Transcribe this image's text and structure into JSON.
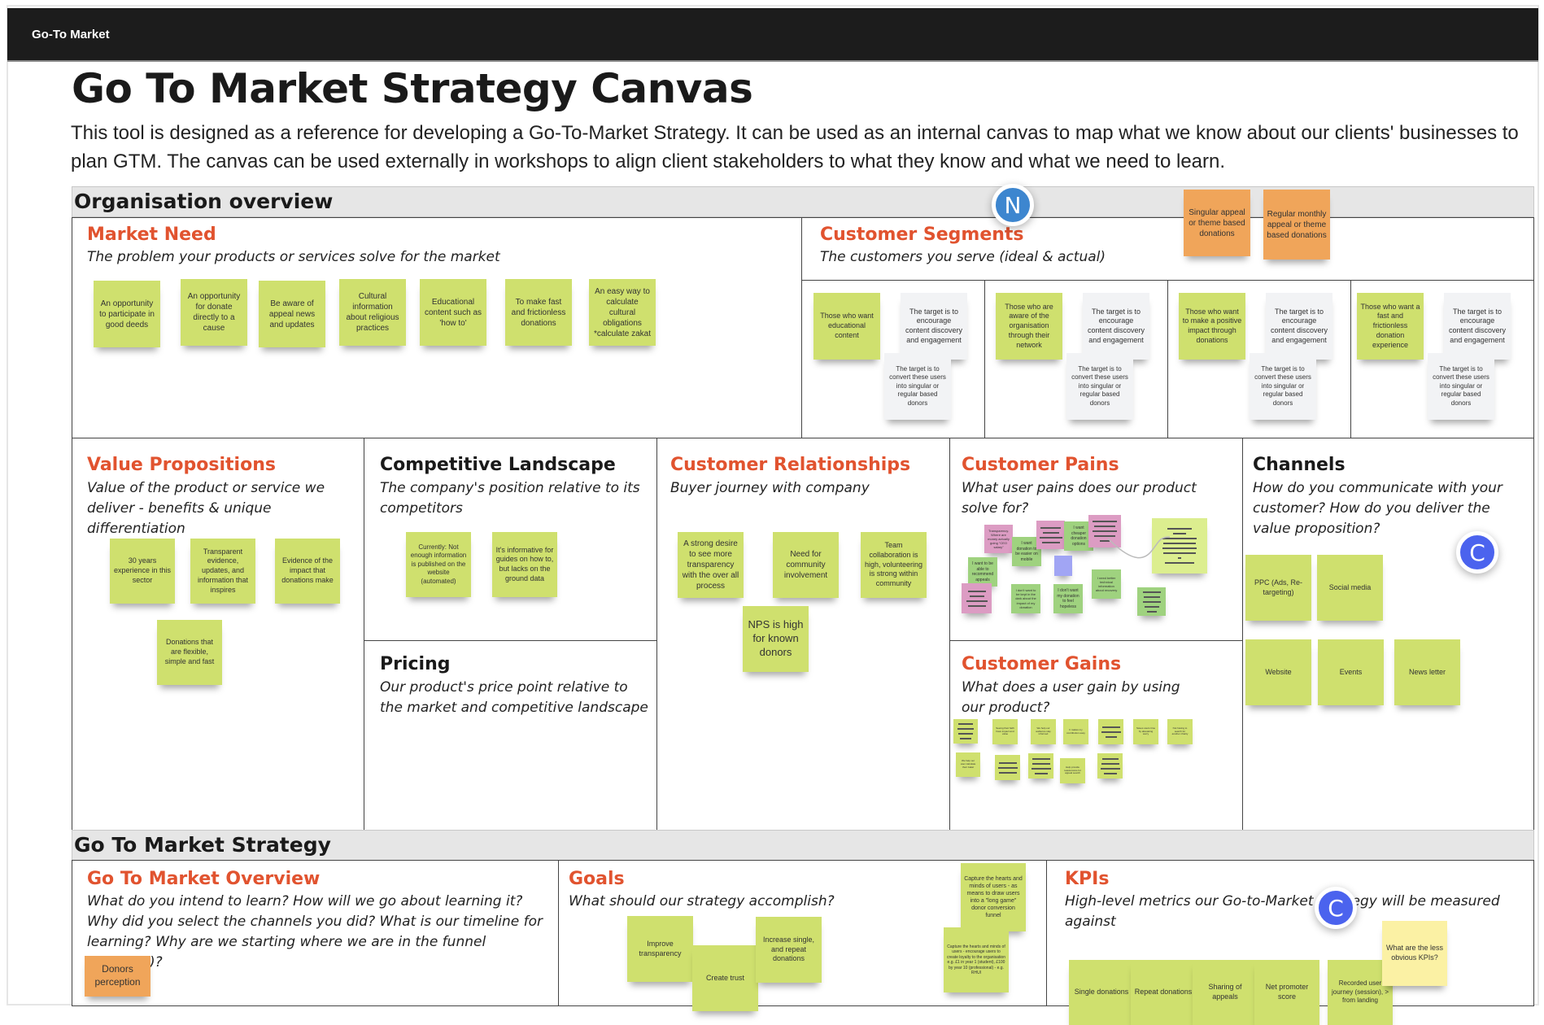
{
  "app": {
    "board_name": "Go-To Market"
  },
  "header": {
    "title": "Go To Market Strategy Canvas",
    "description": "This tool is designed as a reference for developing a Go-To-Market Strategy. It can be used as an internal canvas to map what we know about our clients' businesses to plan GTM. The canvas can be used externally in workshops to align client stakeholders to what they know and what we need to learn."
  },
  "sections": {
    "org_overview": "Organisation overview",
    "gtm_strategy": "Go To Market Strategy"
  },
  "collaborators": [
    {
      "initial": "N",
      "icon": "user-avatar-icon",
      "color": "#3d86cf"
    },
    {
      "initial": "C",
      "icon": "user-avatar-icon",
      "color": "#4b63ee"
    },
    {
      "initial": "C",
      "icon": "user-avatar-icon",
      "color": "#4b63ee"
    }
  ],
  "market_need": {
    "title": "Market Need",
    "subtitle": "The problem your products or services solve for the market",
    "stickies": [
      "An opportunity to participate in good deeds",
      "An opportunity for donate directly to a cause",
      "Be aware of appeal news and updates",
      "Cultural information about religious practices",
      "Educational content such as 'how to'",
      "To make fast and frictionless donations",
      "An easy way to calculate cultural obligations *calculate zakat"
    ]
  },
  "customer_segments": {
    "title": "Customer Segments",
    "subtitle": "The customers you serve (ideal & actual)",
    "header_stickies": [
      "Singular appeal or theme based donations",
      "Regular monthly appeal or theme based donations"
    ],
    "segments": [
      {
        "segment": "Those who want educational content",
        "target1": "The target is to encourage content discovery and engagement",
        "target2": "The target is to convert these users into singular or regular based donors"
      },
      {
        "segment": "Those who are aware of the organisation through their network",
        "target1": "The target is to encourage content discovery and engagement",
        "target2": "The target is to convert these users into singular or regular based donors"
      },
      {
        "segment": "Those who want to make a positive impact through donations",
        "target1": "The target is to encourage content discovery and engagement",
        "target2": "The target is to convert these users into singular or regular based donors"
      },
      {
        "segment": "Those who want a fast and frictionless donation experience",
        "target1": "The target is to encourage content discovery and engagement",
        "target2": "The target is to convert these users into singular or regular based donors"
      }
    ]
  },
  "value_propositions": {
    "title": "Value Propositions",
    "subtitle": "Value of the product or service we deliver - benefits & unique differentiation",
    "stickies": [
      "30 years experience in this sector",
      "Transparent evidence, updates, and information that inspires",
      "Evidence of the impact that donations make",
      "Donations that are flexible, simple and fast"
    ]
  },
  "competitive_landscape": {
    "title": "Competitive Landscape",
    "subtitle": "The company's position relative to its competitors",
    "stickies": [
      "Currently: Not enough information is published on the website (automated)",
      "It's informative for guides on how to, but lacks on the ground data"
    ]
  },
  "pricing": {
    "title": "Pricing",
    "subtitle": "Our product's price point relative to the market and competitive landscape"
  },
  "customer_relationships": {
    "title": "Customer Relationships",
    "subtitle": "Buyer journey with company",
    "stickies": [
      "A strong desire to see more transparency with the over all process",
      "Need for community involvement",
      "Team collaboration is high, volunteering is strong within community",
      "NPS is high for known donors"
    ]
  },
  "customer_pains": {
    "title": "Customer Pains",
    "subtitle": "What user pains does our product solve for?",
    "stickies": [
      "Transparency. Where are money actually going \"CEO salary\"",
      "I want donation to be easier on mobile",
      "I want cheaper donation options",
      "I want to be able to recommend appeals",
      "I don't want to be kept in the dark about the impact of my donation",
      "I don't want my donation to feel hopeless",
      "I need better technical information about recovery"
    ]
  },
  "customer_gains": {
    "title": "Customer Gains",
    "subtitle": "What does a user gain by using our product?",
    "stickies": [
      "Seeing their faith have impact and value",
      "We help our audience stay informed",
      "It makes my contribution easy",
      "Saves users time by alleviating worry",
      "Not having to search for another charity",
      "We help our user calculate their zakat",
      "Help provide reassurance for appeal search"
    ]
  },
  "channels": {
    "title": "Channels",
    "subtitle": "How do you communicate with your customer? How do you deliver the value proposition?",
    "stickies": [
      "PPC (Ads, Re-targeting)",
      "Social media",
      "Website",
      "Events",
      "News letter"
    ]
  },
  "gtm_overview": {
    "title": "Go To Market Overview",
    "subtitle": "What do you intend to learn? How will we go about learning it? Why did you select the channels you did? What is our timeline for learning? Why are we starting where we are in the funnel (AAARRR)?",
    "stickies": [
      "Donors perception"
    ]
  },
  "goals": {
    "title": "Goals",
    "subtitle": "What should our strategy accomplish?",
    "stickies": [
      "Improve transparency",
      "Create trust",
      "Increase single, and repeat donations",
      "Capture the hearts and minds of users - as means to draw users into a \"long game\" donor conversion funnel",
      "Capture the hearts and minds of users - encourage users to create loyalty to the organisation e.g. £1 in year 1 (student), £100 by year 10 (professional) - e.g. RHUI"
    ]
  },
  "kpis": {
    "title": "KPIs",
    "subtitle": "High-level metrics our Go-to-Market Strategy will be measured against",
    "stickies": [
      "Single donations",
      "Repeat donations",
      "Sharing of appeals",
      "Net promoter score",
      "Recorded user journey (session), > from landing",
      "What are the less obvious KPIs?"
    ]
  }
}
